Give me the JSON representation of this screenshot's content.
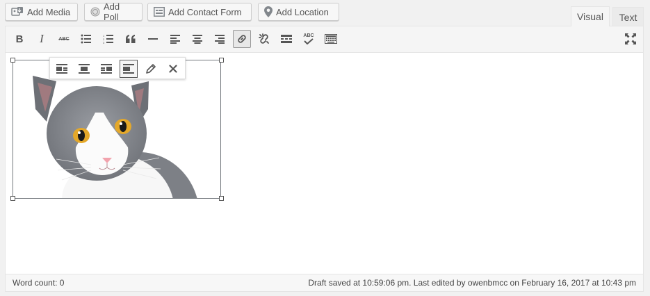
{
  "media_buttons": {
    "add_media": "Add Media",
    "add_poll": "Add Poll",
    "add_contact_form": "Add Contact Form",
    "add_location": "Add Location"
  },
  "tabs": {
    "visual": "Visual",
    "text": "Text"
  },
  "toolbar": {
    "buttons": [
      "bold",
      "italic",
      "strikethrough",
      "bullet-list",
      "numbered-list",
      "blockquote",
      "horizontal-rule",
      "align-left",
      "align-center",
      "align-right",
      "link",
      "unlink",
      "read-more",
      "spellcheck",
      "toolbar-toggle"
    ],
    "active": "link",
    "italic_glyph": "I",
    "bold_glyph": "B",
    "strike_glyph": "ABC",
    "spell_glyph": "ABC"
  },
  "image_toolbar": {
    "buttons": [
      "align-left",
      "align-center",
      "align-right",
      "align-none",
      "edit",
      "remove"
    ],
    "active": "align-none"
  },
  "status": {
    "word_count": "Word count: 0",
    "draft": "Draft saved at 10:59:06 pm. Last edited by owenbmcc on February 16, 2017 at 10:43 pm"
  },
  "colors": {
    "accent": "#0073aa",
    "border": "#e5e5e5",
    "toolbar_bg": "#f5f5f5"
  }
}
